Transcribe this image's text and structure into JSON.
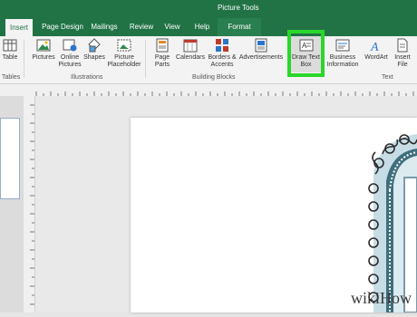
{
  "app": {
    "context_label": "Picture Tools"
  },
  "tabs": [
    {
      "label": "Insert"
    },
    {
      "label": "Page Design"
    },
    {
      "label": "Mailings"
    },
    {
      "label": "Review"
    },
    {
      "label": "View"
    },
    {
      "label": "Help"
    },
    {
      "label": "Format"
    }
  ],
  "ribbon": {
    "table": "Table",
    "pictures": "Pictures",
    "online_pictures": "Online Pictures",
    "shapes": "Shapes",
    "picture_placeholder": "Picture Placeholder",
    "page_parts": "Page Parts",
    "calendars": "Calendars",
    "borders_accents": "Borders & Accents",
    "advertisements": "Advertisements",
    "draw_text_box": "Draw Text Box",
    "business_information": "Business Information",
    "wordart": "WordArt",
    "insert_file": "Insert File",
    "groups": {
      "tables": "Tables",
      "illustrations": "Illustrations",
      "building_blocks": "Building Blocks",
      "text": "Text"
    }
  },
  "watermark": "wikiHow",
  "colors": {
    "accent": "#217346",
    "highlight": "#2bd62b"
  }
}
